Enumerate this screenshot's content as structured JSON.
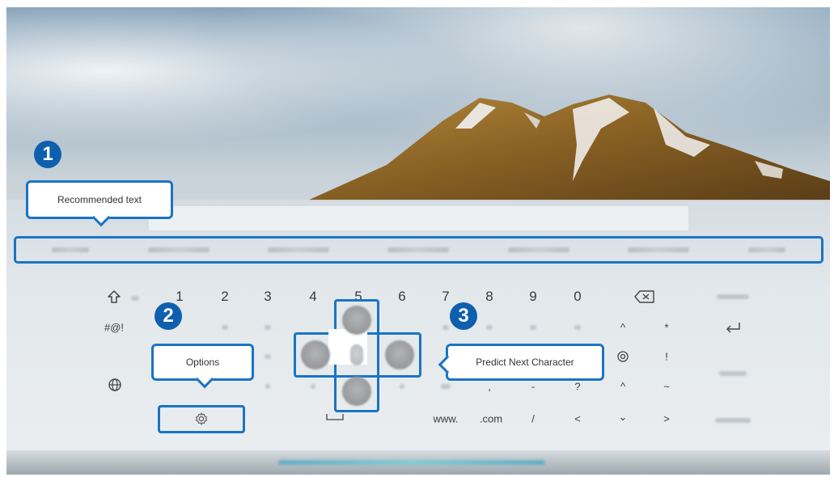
{
  "callouts": {
    "recommended_text": "Recommended text",
    "options": "Options",
    "predict_next_character": "Predict Next Character"
  },
  "badges": [
    "1",
    "2",
    "3"
  ],
  "keyboard": {
    "number_row": [
      "1",
      "2",
      "3",
      "4",
      "5",
      "6",
      "7",
      "8",
      "9",
      "0"
    ],
    "symbol_row_right": [
      "^",
      "*"
    ],
    "row3_right": [
      "@",
      "!"
    ],
    "row4_right": [
      ",",
      "-",
      "?",
      "^",
      "~"
    ],
    "bottom_row": {
      "www": "www.",
      "com": ".com",
      "slash": "/",
      "left": "<",
      "down": "⌄",
      "right": ">"
    },
    "symbols_toggle": "#@!"
  },
  "icons": {
    "shift": "shift-icon",
    "backspace": "backspace-icon",
    "enter": "enter-icon",
    "globe": "globe-icon",
    "settings": "gear-icon",
    "space": "space-icon"
  },
  "colors": {
    "accent": "#1a74c4",
    "badge": "#0e5fae"
  }
}
